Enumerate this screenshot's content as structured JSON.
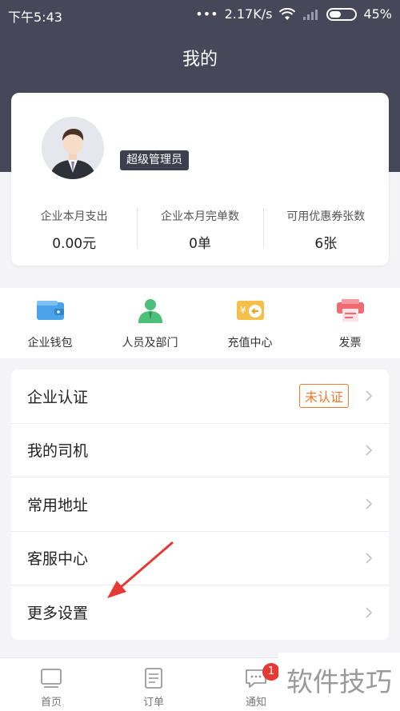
{
  "status_bar": {
    "time": "下午5:43",
    "dots": "•••",
    "network_speed": "2.17K/s",
    "battery": "45%"
  },
  "header": {
    "title": "我的"
  },
  "profile": {
    "role": "超级管理员",
    "stats": [
      {
        "label": "企业本月支出",
        "value": "0.00元"
      },
      {
        "label": "企业本月完单数",
        "value": "0单"
      },
      {
        "label": "可用优惠券张数",
        "value": "6张"
      }
    ]
  },
  "shortcuts": [
    {
      "label": "企业钱包",
      "icon": "wallet-icon",
      "color": "#4aa3e8"
    },
    {
      "label": "人员及部门",
      "icon": "person-icon",
      "color": "#4cc07a"
    },
    {
      "label": "充值中心",
      "icon": "recharge-icon",
      "color": "#f0b43c"
    },
    {
      "label": "发票",
      "icon": "invoice-icon",
      "color": "#f06a72"
    }
  ],
  "menu": {
    "items": [
      {
        "label": "企业认证",
        "badge": "未认证"
      },
      {
        "label": "我的司机"
      },
      {
        "label": "常用地址"
      },
      {
        "label": "客服中心"
      },
      {
        "label": "更多设置"
      }
    ]
  },
  "tabbar": {
    "tabs": [
      {
        "label": "首页",
        "icon": "home-icon"
      },
      {
        "label": "订单",
        "icon": "order-icon"
      },
      {
        "label": "通知",
        "icon": "notification-icon",
        "badge": "1"
      }
    ]
  },
  "watermark": "软件技巧",
  "colors": {
    "header_bg": "#46485a",
    "accent_orange": "#f07a2c",
    "annotation_red": "#e53935"
  }
}
